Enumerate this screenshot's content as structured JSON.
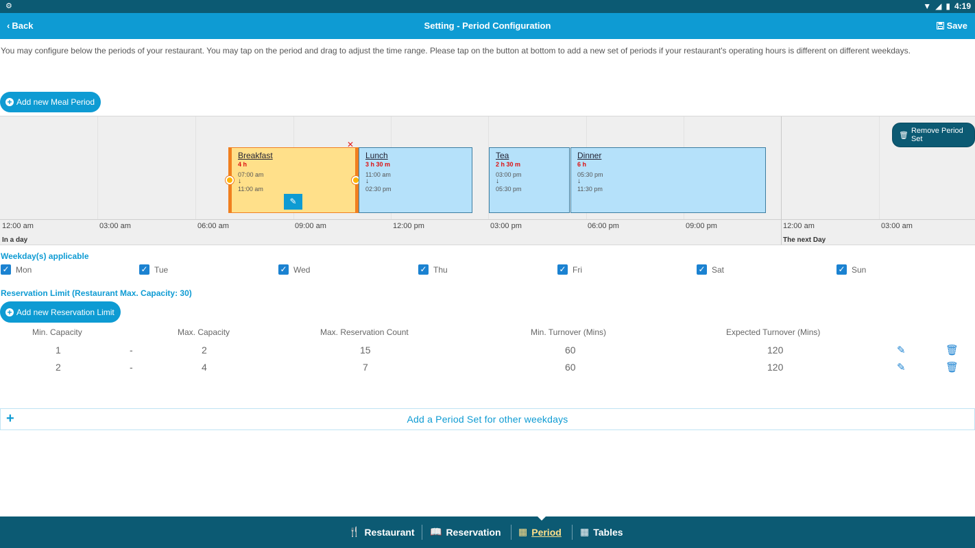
{
  "status_bar": {
    "left_icon": "notification-icon",
    "time": "4:19"
  },
  "app_bar": {
    "back_label": "Back",
    "title": "Setting - Period Configuration",
    "save_label": "Save"
  },
  "intro_text": "You may configure below the periods of your restaurant. You may tap on the period and drag to adjust the time range. Please tap on the button at bottom to add a new set of periods if your restaurant's operating hours is different on different weekdays.",
  "add_meal_period_label": "Add new Meal Period",
  "timeline": {
    "remove_set_label": "Remove Period Set",
    "ticks": [
      "12:00 am",
      "03:00 am",
      "06:00 am",
      "09:00 am",
      "12:00 pm",
      "03:00 pm",
      "06:00 pm",
      "09:00 pm",
      "12:00 am",
      "03:00 am"
    ],
    "day_label": "In a day",
    "next_day_label": "The next Day",
    "periods": [
      {
        "name": "Breakfast",
        "duration": "4 h",
        "start": "07:00 am",
        "end": "11:00 am"
      },
      {
        "name": "Lunch",
        "duration": "3 h 30 m",
        "start": "11:00 am",
        "end": "02:30 pm"
      },
      {
        "name": "Tea",
        "duration": "2 h 30 m",
        "start": "03:00 pm",
        "end": "05:30 pm"
      },
      {
        "name": "Dinner",
        "duration": "6 h",
        "start": "05:30 pm",
        "end": "11:30 pm"
      }
    ]
  },
  "weekdays": {
    "title": "Weekday(s) applicable",
    "days": [
      "Mon",
      "Tue",
      "Wed",
      "Thu",
      "Fri",
      "Sat",
      "Sun"
    ]
  },
  "reservation_limit": {
    "title": "Reservation Limit (Restaurant Max. Capacity: 30)",
    "add_label": "Add new Reservation Limit",
    "headers": [
      "Min. Capacity",
      "Max. Capacity",
      "Max. Reservation Count",
      "Min. Turnover (Mins)",
      "Expected Turnover (Mins)"
    ],
    "separator": "-",
    "rows": [
      {
        "min": "1",
        "max": "2",
        "count": "15",
        "min_turnover": "60",
        "expected_turnover": "120"
      },
      {
        "min": "2",
        "max": "4",
        "count": "7",
        "min_turnover": "60",
        "expected_turnover": "120"
      }
    ]
  },
  "add_period_set_label": "Add a Period Set for other weekdays",
  "bottom_nav": [
    {
      "label": "Restaurant",
      "icon": "fork-knife-icon"
    },
    {
      "label": "Reservation",
      "icon": "book-icon"
    },
    {
      "label": "Period",
      "icon": "calendar-icon"
    },
    {
      "label": "Tables",
      "icon": "grid-icon"
    }
  ]
}
